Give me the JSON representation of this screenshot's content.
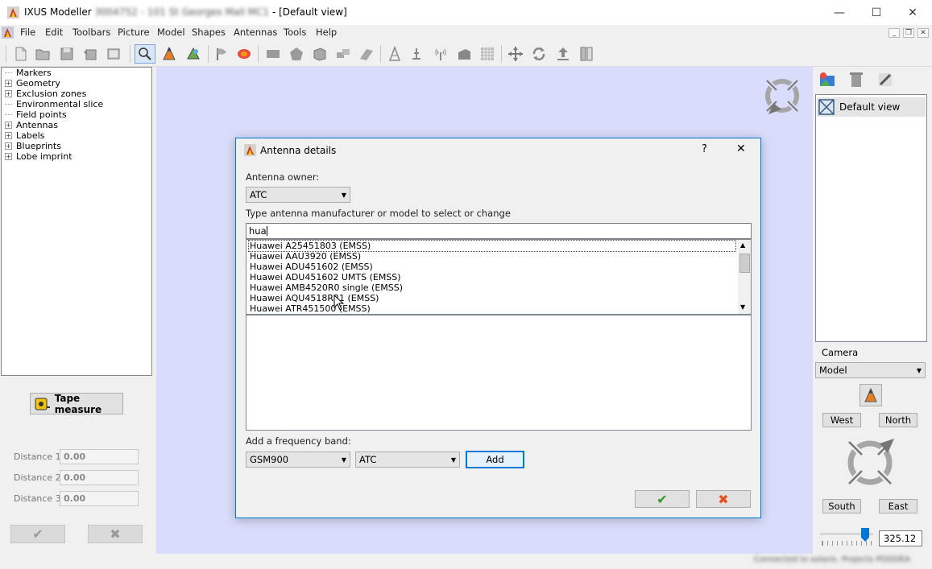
{
  "window": {
    "app_name": "IXUS Modeller",
    "redacted_part": "3004752 - 101 St Georges Mall MC1",
    "view_suffix": "- [Default view]",
    "minimize_glyph": "—",
    "maximize_glyph": "☐",
    "close_glyph": "✕"
  },
  "menu": [
    "File",
    "Edit",
    "Toolbars",
    "Picture",
    "Model",
    "Shapes",
    "Antennas",
    "Tools",
    "Help"
  ],
  "tree": [
    {
      "label": "Markers",
      "expandable": false
    },
    {
      "label": "Geometry",
      "expandable": true
    },
    {
      "label": "Exclusion zones",
      "expandable": true
    },
    {
      "label": "Environmental slice",
      "expandable": false
    },
    {
      "label": "Field points",
      "expandable": false
    },
    {
      "label": "Antennas",
      "expandable": true
    },
    {
      "label": "Labels",
      "expandable": true
    },
    {
      "label": "Blueprints",
      "expandable": true
    },
    {
      "label": "Lobe imprint",
      "expandable": true
    }
  ],
  "left_panel": {
    "tape_measure_label": "Tape measure",
    "distances": [
      {
        "label": "Distance 1",
        "value": "0.00"
      },
      {
        "label": "Distance 2",
        "value": "0.00"
      },
      {
        "label": "Distance 3",
        "value": "0.00"
      }
    ],
    "ok_glyph": "✔",
    "cancel_glyph": "✖"
  },
  "right_panel": {
    "view_item": "Default view",
    "camera_label": "Camera",
    "camera_mode": "Model",
    "west": "West",
    "north": "North",
    "south": "South",
    "east": "East",
    "zoom_value": "325.12"
  },
  "status_text": "Connected to solaris. Projects PDDDEA",
  "dialog": {
    "title": "Antenna details",
    "help_glyph": "?",
    "close_glyph": "✕",
    "owner_label": "Antenna owner:",
    "owner_value": "ATC",
    "search_label": "Type antenna manufacturer or model to select or change",
    "search_value": "hua",
    "results": [
      "Huawei  A25451803 (EMSS)",
      "Huawei  AAU3920 (EMSS)",
      "Huawei  ADU451602 (EMSS)",
      "Huawei  ADU451602 UMTS (EMSS)",
      "Huawei  AMB4520R0 single (EMSS)",
      "Huawei  AQU4518R21 (EMSS)",
      "Huawei  ATR451500 (EMSS)"
    ],
    "freq_label": "Add a frequency band:",
    "band_value": "GSM900",
    "band_owner_value": "ATC",
    "add_label": "Add",
    "ok_glyph": "✔",
    "cancel_glyph": "✖"
  },
  "colors": {
    "viewport_bg": "#d9dcfa",
    "dialog_border": "#0078d7",
    "ok_green": "#2e9a2e",
    "cancel_orange": "#e8501b"
  }
}
